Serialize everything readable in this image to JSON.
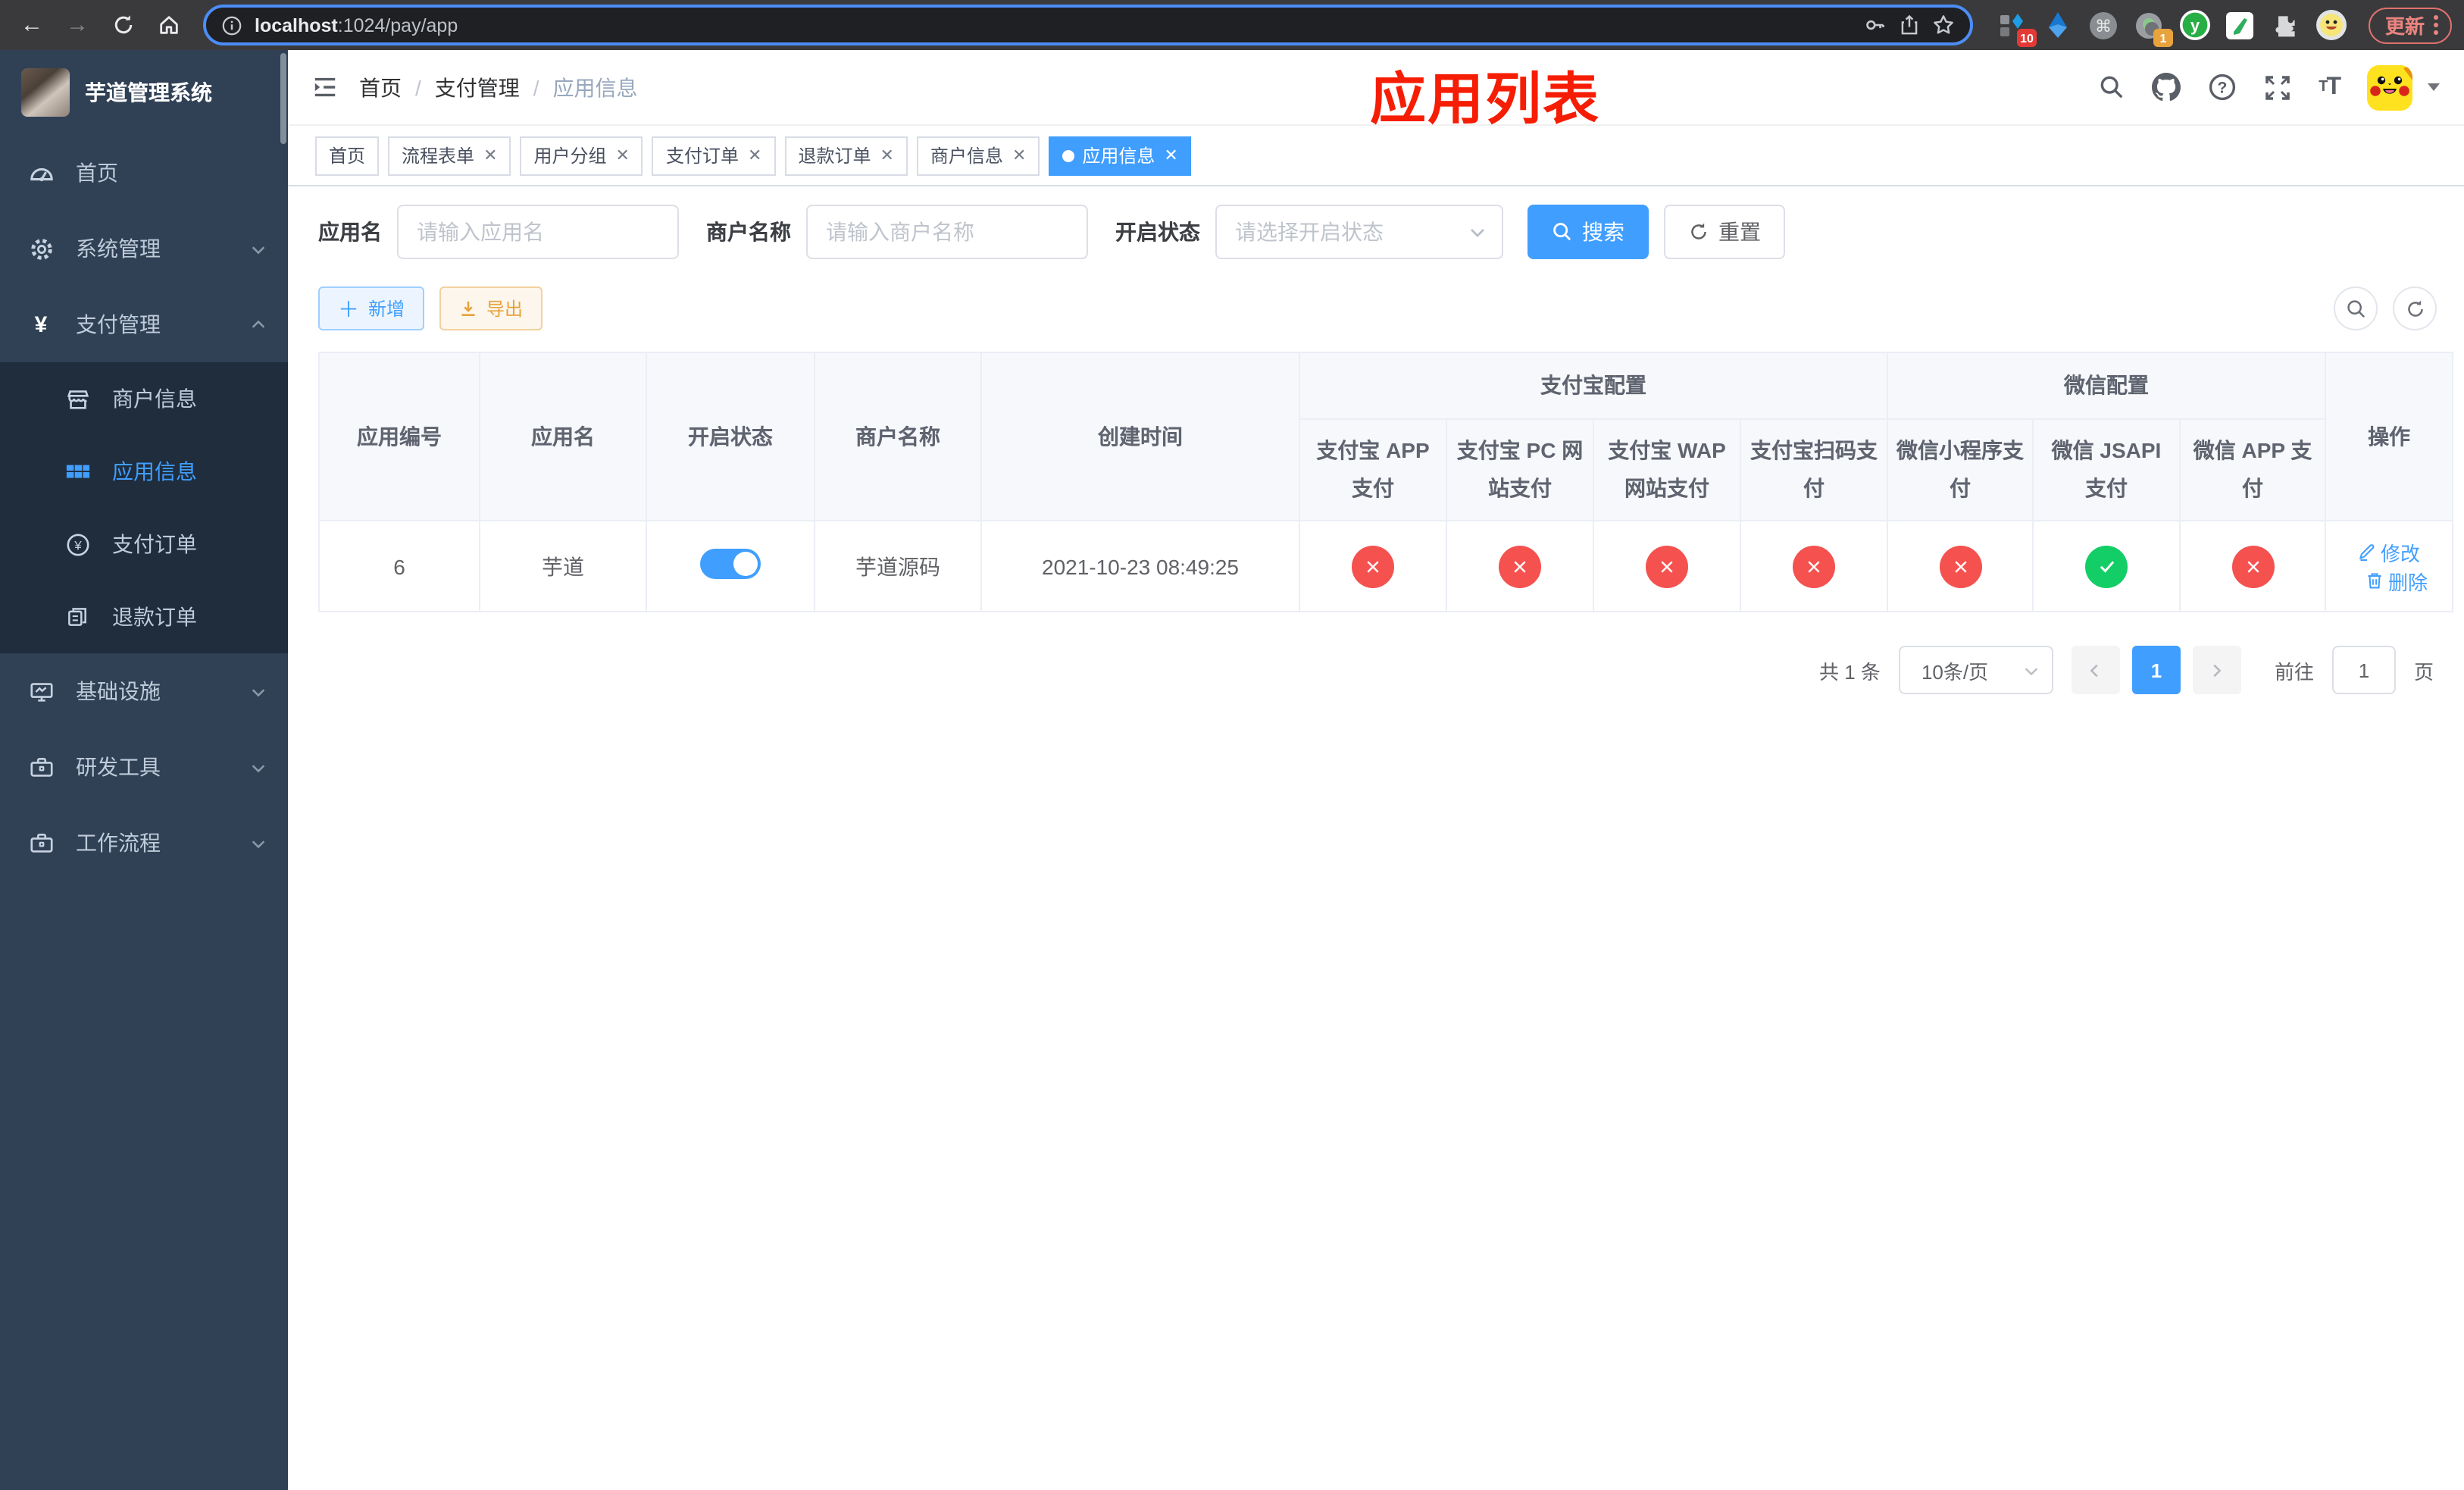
{
  "browser": {
    "url_host": "localhost",
    "url_path": ":1024/pay/app",
    "update_label": "更新",
    "ext_badge_blue": "10",
    "ext_badge_dot": "1",
    "ext_y_letter": "y"
  },
  "sidebar": {
    "title": "芋道管理系统",
    "menu": [
      {
        "label": "首页"
      },
      {
        "label": "系统管理"
      },
      {
        "label": "支付管理"
      }
    ],
    "submenu": [
      {
        "label": "商户信息"
      },
      {
        "label": "应用信息"
      },
      {
        "label": "支付订单"
      },
      {
        "label": "退款订单"
      }
    ],
    "menu_bottom": [
      {
        "label": "基础设施"
      },
      {
        "label": "研发工具"
      },
      {
        "label": "工作流程"
      }
    ]
  },
  "navbar": {
    "breadcrumb": [
      "首页",
      "支付管理",
      "应用信息"
    ],
    "annotation": "应用列表"
  },
  "tabs": [
    {
      "label": "首页"
    },
    {
      "label": "流程表单"
    },
    {
      "label": "用户分组"
    },
    {
      "label": "支付订单"
    },
    {
      "label": "退款订单"
    },
    {
      "label": "商户信息"
    },
    {
      "label": "应用信息"
    }
  ],
  "filters": {
    "app_name_label": "应用名",
    "app_name_placeholder": "请输入应用名",
    "merchant_label": "商户名称",
    "merchant_placeholder": "请输入商户名称",
    "status_label": "开启状态",
    "status_placeholder": "请选择开启状态",
    "search_label": "搜索",
    "reset_label": "重置"
  },
  "toolbar": {
    "add_label": "新增",
    "export_label": "导出"
  },
  "table": {
    "columns": {
      "app_id": "应用编号",
      "app_name": "应用名",
      "status": "开启状态",
      "merchant": "商户名称",
      "created": "创建时间",
      "alipay_group": "支付宝配置",
      "wechat_group": "微信配置",
      "actions": "操作"
    },
    "sub_columns": [
      "支付宝 APP 支付",
      "支付宝 PC 网站支付",
      "支付宝 WAP 网站支付",
      "支付宝扫码支付",
      "微信小程序支付",
      "微信 JSAPI 支付",
      "微信 APP 支付"
    ],
    "rows": [
      {
        "app_id": "6",
        "app_name": "芋道",
        "status_on": true,
        "merchant": "芋道源码",
        "created": "2021-10-23 08:49:25",
        "pay_statuses": [
          "x",
          "x",
          "x",
          "x",
          "x",
          "check",
          "x"
        ],
        "edit_label": "修改",
        "delete_label": "删除"
      }
    ]
  },
  "pagination": {
    "total": "共 1 条",
    "page_size": "10条/页",
    "current_page": "1",
    "goto_label": "前往",
    "goto_value": "1",
    "page_unit": "页"
  },
  "colors": {
    "primary": "#409eff",
    "danger": "#f4514f",
    "success": "#13ce66",
    "annotation_red": "#f61d05",
    "sidebar_bg": "#304156",
    "submenu_bg": "#1f2d3d"
  }
}
